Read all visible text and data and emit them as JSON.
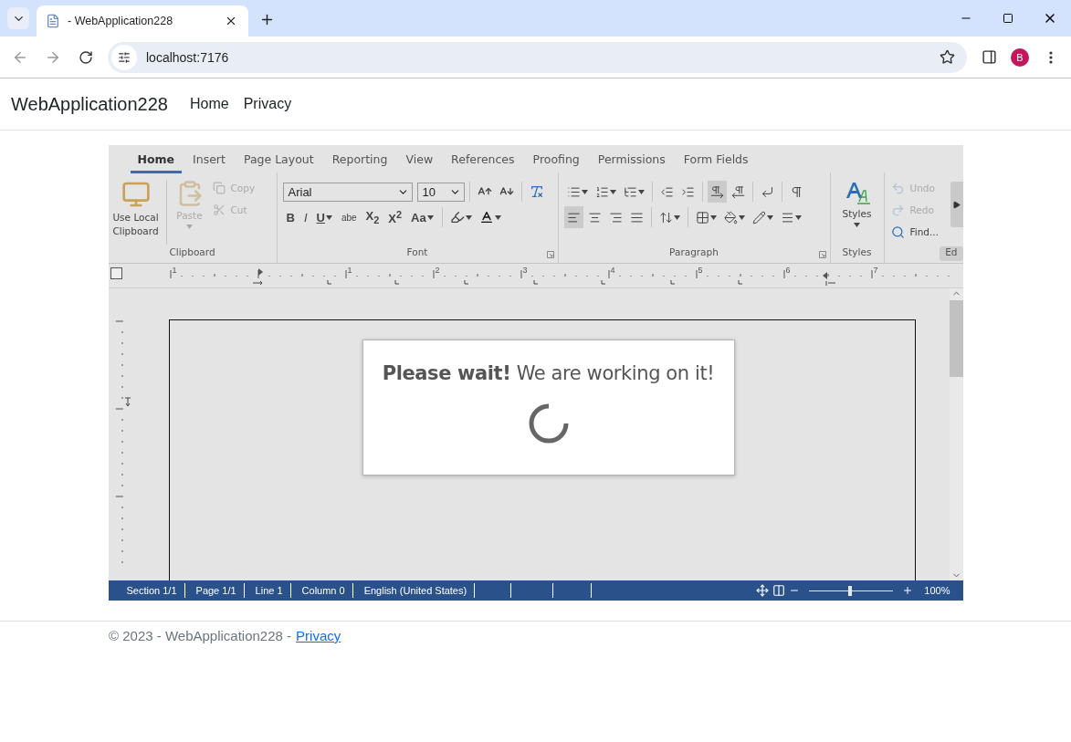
{
  "browser": {
    "tab_title": "- WebApplication228",
    "address": "localhost:7176",
    "profile_initial": "B"
  },
  "navbar": {
    "brand": "WebApplication228",
    "links": [
      {
        "label": "Home"
      },
      {
        "label": "Privacy"
      }
    ]
  },
  "editor": {
    "tabs": [
      {
        "label": "Home",
        "selected": true
      },
      {
        "label": "Insert",
        "selected": false
      },
      {
        "label": "Page Layout",
        "selected": false
      },
      {
        "label": "Reporting",
        "selected": false
      },
      {
        "label": "View",
        "selected": false
      },
      {
        "label": "References",
        "selected": false
      },
      {
        "label": "Proofing",
        "selected": false
      },
      {
        "label": "Permissions",
        "selected": false
      },
      {
        "label": "Form Fields",
        "selected": false
      }
    ],
    "clipboard": {
      "label": "Clipboard",
      "buttons": [
        {
          "label": "Use Local Clipboard",
          "disabled": false
        },
        {
          "label": "Paste",
          "disabled": true
        },
        {
          "label": "Copy",
          "disabled": true
        },
        {
          "label": "Cut",
          "disabled": true
        }
      ]
    },
    "font": {
      "label": "Font",
      "font_name": "Arial",
      "font_size": "10",
      "format_buttons": [
        {
          "kind": "bold",
          "label": "B"
        },
        {
          "kind": "italic",
          "label": "I"
        },
        {
          "kind": "underline",
          "label": "U"
        },
        {
          "kind": "strike",
          "label": "abe"
        },
        {
          "kind": "script",
          "label": "X$_{2}$"
        },
        {
          "kind": "script",
          "label": "X$^{2}$"
        },
        {
          "kind": "case",
          "label": "Aa"
        }
      ]
    },
    "paragraph": {
      "label": "Paragraph",
      "rows": [
        [
          {
            "selected": false
          },
          {
            "selected": false
          },
          {
            "selected": false
          },
          {
            "selected": false
          },
          {
            "selected": false
          },
          {
            "selected": true
          },
          {
            "selected": false
          },
          {
            "selected": false
          },
          {
            "selected": false
          }
        ],
        [
          {
            "selected": true
          },
          {
            "selected": false
          },
          {
            "selected": false
          },
          {
            "selected": false
          },
          {
            "selected": false
          },
          {
            "selected": false
          },
          {
            "selected": false
          },
          {
            "selected": false
          },
          {
            "selected": false
          }
        ]
      ]
    },
    "styles": {
      "button": "Styles",
      "label": "Styles"
    },
    "editing": {
      "label": "Ed",
      "buttons": [
        {
          "label": "Undo",
          "disabled": true
        },
        {
          "label": "Redo",
          "disabled": true
        },
        {
          "label": "Find...",
          "disabled": false
        }
      ]
    },
    "ruler": {
      "numbers": [
        "1",
        "1",
        "2",
        "3",
        "4",
        "5",
        "6",
        "7"
      ]
    },
    "dialog": {
      "message": "**Please wait!** We are working on it!"
    },
    "status_bar": {
      "items": [
        "Section 1/1",
        "Page 1/1",
        "Line 1",
        "Column 0",
        "English (United States)"
      ],
      "zoom": {
        "level": 0.48,
        "reading": "100%"
      }
    }
  },
  "footer": {
    "text": "© 2023 - WebApplication228 -",
    "link": "Privacy"
  }
}
